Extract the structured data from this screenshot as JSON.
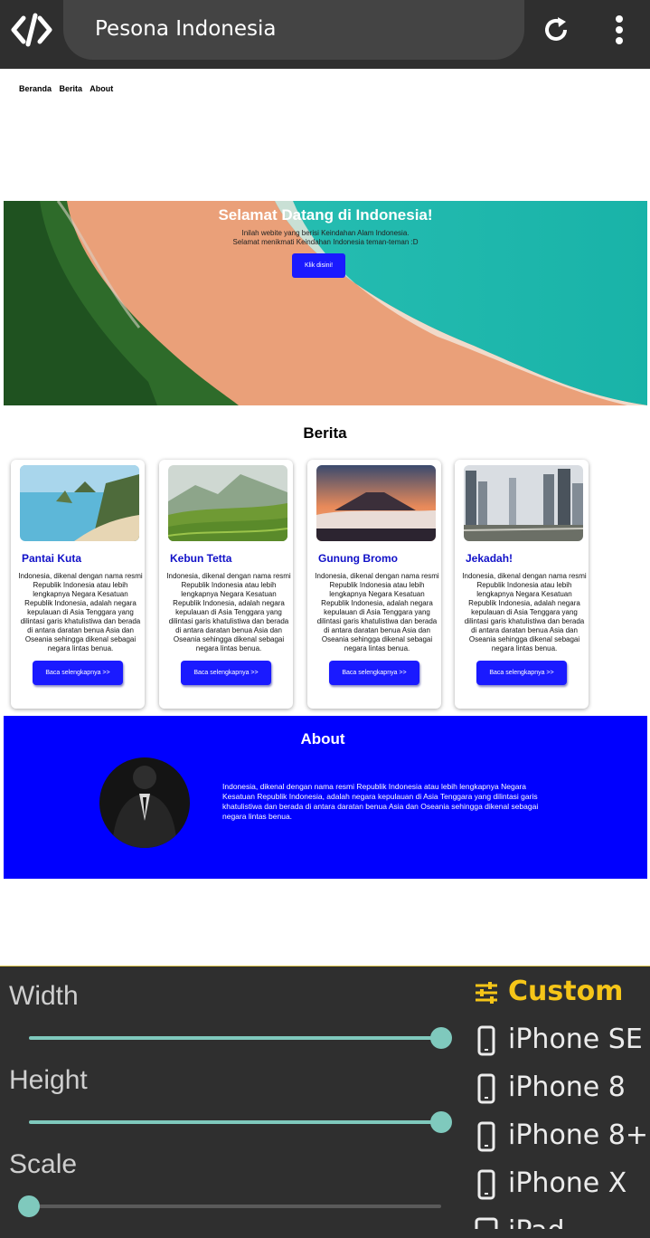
{
  "browser": {
    "title": "Pesona Indonesia"
  },
  "site": {
    "nav": [
      "Beranda",
      "Berita",
      "About"
    ],
    "hero": {
      "title": "Selamat Datang di Indonesia!",
      "line1": "Inilah webite yang berisi Keindahan Alam Indonesia.",
      "line2": "Selamat menikmati Keindahan Indonesia teman-teman :D",
      "button": "Klik disini!"
    },
    "berita": {
      "title": "Berita",
      "cards": [
        {
          "title": "Pantai Kuta",
          "text": "Indonesia, dikenal dengan nama resmi Republik Indonesia atau lebih lengkapnya Negara Kesatuan Republik Indonesia, adalah negara kepulauan di Asia Tenggara yang dilintasi garis khatulistiwa dan berada di antara daratan benua Asia dan Oseania sehingga dikenal sebagai negara lintas benua.",
          "button": "Baca selengkapnya >>"
        },
        {
          "title": "Kebun Tetta",
          "text": "Indonesia, dikenal dengan nama resmi Republik Indonesia atau lebih lengkapnya Negara Kesatuan Republik Indonesia, adalah negara kepulauan di Asia Tenggara yang dilintasi garis khatulistiwa dan berada di antara daratan benua Asia dan Oseania sehingga dikenal sebagai negara lintas benua.",
          "button": "Baca selengkapnya >>"
        },
        {
          "title": "Gunung Bromo",
          "text": "Indonesia, dikenal dengan nama resmi Republik Indonesia atau lebih lengkapnya Negara Kesatuan Republik Indonesia, adalah negara kepulauan di Asia Tenggara yang dilintasi garis khatulistiwa dan berada di antara daratan benua Asia dan Oseania sehingga dikenal sebagai negara lintas benua.",
          "button": "Baca selengkapnya >>"
        },
        {
          "title": "Jekadah!",
          "text": "Indonesia, dikenal dengan nama resmi Republik Indonesia atau lebih lengkapnya Negara Kesatuan Republik Indonesia, adalah negara kepulauan di Asia Tenggara yang dilintasi garis khatulistiwa dan berada di antara daratan benua Asia dan Oseania sehingga dikenal sebagai negara lintas benua.",
          "button": "Baca selengkapnya >>"
        }
      ]
    },
    "about": {
      "title": "About",
      "text": "Indonesia, dikenal dengan nama resmi Republik Indonesia atau lebih lengkapnya Negara Kesatuan Republik Indonesia, adalah negara kepulauan di Asia Tenggara yang dilintasi garis khatulistiwa dan berada di antara daratan benua Asia dan Oseania sehingga dikenal sebagai negara lintas benua."
    }
  },
  "panel": {
    "width_label": "Width",
    "height_label": "Height",
    "scale_label": "Scale",
    "width_value": 1.0,
    "height_value": 1.0,
    "scale_value": 0.0,
    "devices": [
      {
        "label": "Custom",
        "icon": "tune-icon",
        "active": true
      },
      {
        "label": "iPhone SE",
        "icon": "phone-icon",
        "active": false
      },
      {
        "label": "iPhone 8",
        "icon": "phone-icon",
        "active": false
      },
      {
        "label": "iPhone 8+",
        "icon": "phone-icon",
        "active": false
      },
      {
        "label": "iPhone X",
        "icon": "phone-icon",
        "active": false
      },
      {
        "label": "iPad",
        "icon": "tablet-icon",
        "active": false
      }
    ]
  },
  "colors": {
    "accent": "#f5c518",
    "slider": "#7fc9bd",
    "site_blue": "#0000ff"
  }
}
